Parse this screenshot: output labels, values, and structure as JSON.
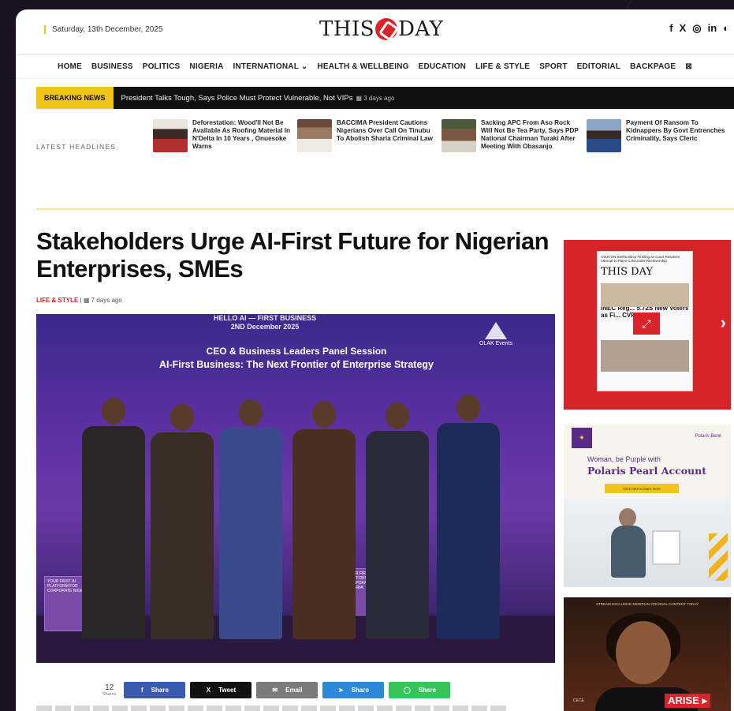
{
  "header": {
    "date": "Saturday, 13th December, 2025",
    "logo_left": "THIS",
    "logo_right": "DAY",
    "social_icons": [
      "facebook-icon",
      "x-icon",
      "instagram-icon",
      "linkedin-icon",
      "dark-mode-icon"
    ],
    "social_glyphs": [
      "f",
      "X",
      "◎",
      "in",
      "◐"
    ]
  },
  "nav": {
    "items": [
      "HOME",
      "BUSINESS",
      "POLITICS",
      "NIGERIA",
      "INTERNATIONAL ⌄",
      "HEALTH & WELLBEING",
      "EDUCATION",
      "LIFE & STYLE",
      "SPORT",
      "EDITORIAL",
      "BACKPAGE",
      "⊠"
    ]
  },
  "breaking": {
    "label": "BREAKING NEWS",
    "text": "President Talks Tough, Says Police Must Protect Vulnerable, Not VIPs",
    "ago": "▦ 3 days ago"
  },
  "latest": {
    "label": "LATEST HEADLINES",
    "items": [
      "Deforestation: Wood'll Not Be Available As Roofing Material In N'Delta In 10 Years , Onuesoke Warns",
      "BACCIMA President Cautions Nigerians Over Call On Tinubu To Abolish Sharia Criminal Law",
      "Sacking APC From Aso Rock Will Not Be Tea Party, Says PDP National Chairman Turaki After Meeting With Obasanjo",
      "Payment Of Ransom To Kidnappers By Govt Entrenches Criminality, Says Cleric"
    ]
  },
  "article": {
    "title": "Stakeholders Urge AI-First Future for Nigerian Enterprises, SMEs",
    "category": "LIFE & STYLE",
    "ago": "▦ 7 days ago",
    "hero_top": "HELLO AI — FIRST BUSINESS",
    "hero_date": "2ND December 2025",
    "hero_line1": "CEO & Business Leaders Panel Session",
    "hero_line2": "AI-First Business: The Next Frontier of Enterprise Strategy",
    "hero_brand": "OLAK Events",
    "screen_left": "YOUR FIRST AI PLATFORM FOR CORPORATE NIGERIA",
    "screen_right": "YOUR FIRST AI PLATFORM FOR CORPORATE NIGERIA"
  },
  "share": {
    "count": "12",
    "count_label": "Shares",
    "buttons": [
      {
        "label": "Share",
        "icon": "f",
        "color": "#3b5ab0"
      },
      {
        "label": "Tweet",
        "icon": "X",
        "color": "#111111"
      },
      {
        "label": "Email",
        "icon": "✉",
        "color": "#7a7a7a"
      },
      {
        "label": "Share",
        "icon": "➤",
        "color": "#2e8ad6"
      },
      {
        "label": "Share",
        "icon": "◯",
        "color": "#37c45a"
      }
    ]
  },
  "ads": {
    "paper_header": "ASUCON Seeks Minor Tinkling as Court Resolves Attempt to Place CJN Under Receivership",
    "paper_name": "THIS DAY",
    "paper_story": "INEC Reg... 5.72S New Voters as Fi... CVR Ends",
    "polaris_small": "Polaris Bank",
    "polaris_line1": "Woman, be Purple with",
    "polaris_line2": "Polaris Pearl Account",
    "polaris_cta": "Click here to learn more",
    "ad3_top": "STREAM EXCLUSIVE NIGERIAN ORIGINAL CONTENT TODAY",
    "ad3_tag": "ARISE ▸",
    "ad3_label": "CECE"
  },
  "colors": {
    "brand_red": "#d8232a",
    "accent_yellow": "#f0c419",
    "hero_purple": "#5a2fa0"
  }
}
